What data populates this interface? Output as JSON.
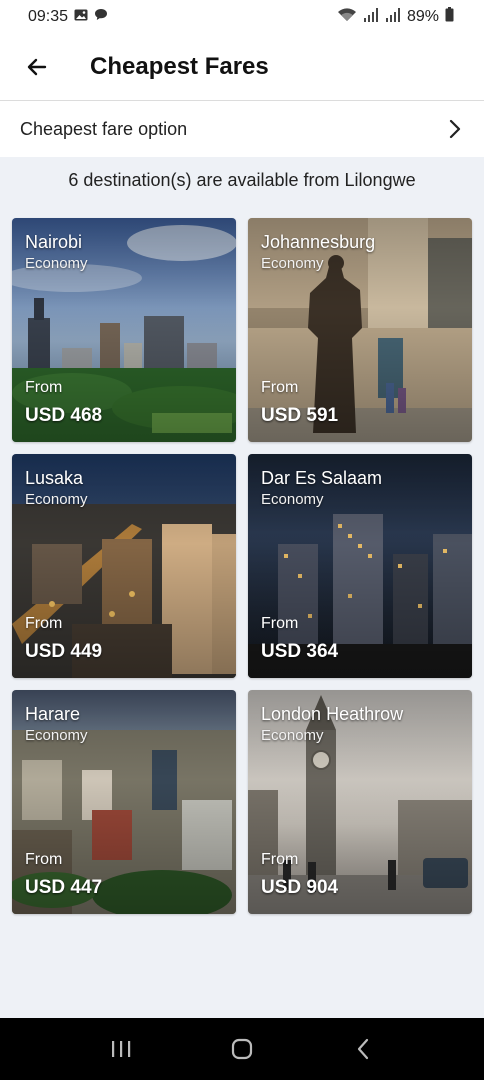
{
  "status_bar": {
    "time": "09:35",
    "battery": "89%",
    "icons": [
      "gallery-icon",
      "chat-icon",
      "wifi-icon",
      "signal-icon",
      "signal-icon",
      "battery-icon"
    ]
  },
  "header": {
    "title": "Cheapest Fares",
    "back_icon": "arrow-left-icon"
  },
  "option_row": {
    "label": "Cheapest fare option",
    "icon": "chevron-right-icon"
  },
  "summary": "6 destination(s) are available from Lilongwe",
  "destinations": [
    {
      "city": "Nairobi",
      "class": "Economy",
      "from": "From",
      "price": "USD 468"
    },
    {
      "city": "Johannesburg",
      "class": "Economy",
      "from": "From",
      "price": "USD 591"
    },
    {
      "city": "Lusaka",
      "class": "Economy",
      "from": "From",
      "price": "USD 449"
    },
    {
      "city": "Dar Es Salaam",
      "class": "Economy",
      "from": "From",
      "price": "USD 364"
    },
    {
      "city": "Harare",
      "class": "Economy",
      "from": "From",
      "price": "USD 447"
    },
    {
      "city": "London Heathrow",
      "class": "Economy",
      "from": "From",
      "price": "USD 904"
    }
  ],
  "nav_bar": {
    "icons": [
      "recent-apps-icon",
      "home-icon",
      "back-icon"
    ]
  },
  "colors": {
    "background": "#eef1f6",
    "surface": "#ffffff",
    "nav_bar": "#000000"
  }
}
